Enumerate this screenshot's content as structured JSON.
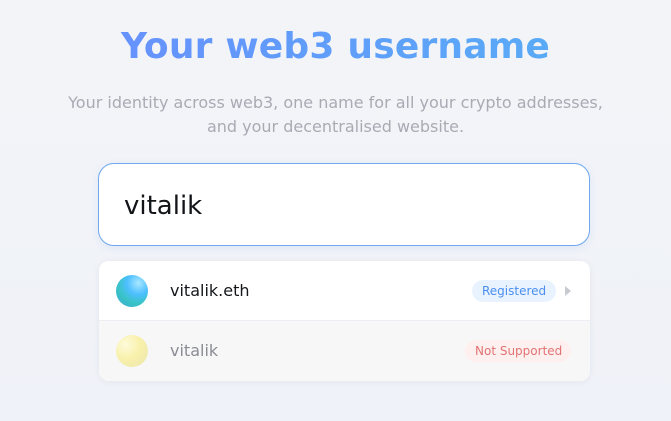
{
  "header": {
    "title": "Your web3 username",
    "subtitle_line_1": "Your identity across web3, one name for all your crypto addresses,",
    "subtitle_line_2": "and your decentralised website."
  },
  "search": {
    "value": "vitalik"
  },
  "results": [
    {
      "name": "vitalik.eth",
      "status": "Registered"
    },
    {
      "name": "vitalik",
      "status": "Not Supported"
    }
  ]
}
